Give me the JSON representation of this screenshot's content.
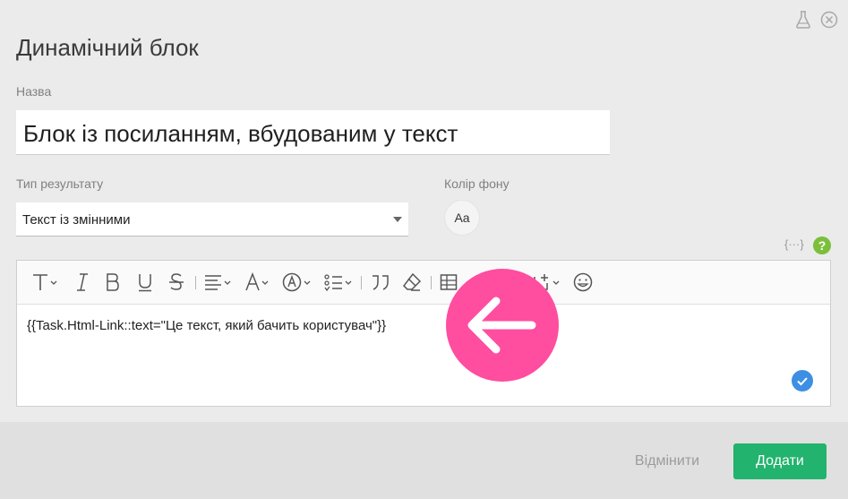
{
  "dialog": {
    "title": "Динамічний блок",
    "name_label": "Назва",
    "name_value": "Блок із посиланням, вбудованим у текст",
    "result_type_label": "Тип результату",
    "result_type_value": "Текст із змінними",
    "bg_color_label": "Колір фону",
    "bg_color_sample": "Aa",
    "variables_icon_text": "{···}",
    "help_icon_text": "?"
  },
  "editor": {
    "content": "{{Task.Html-Link::text=\"Це текст, який бачить користувач\"}}",
    "toolbar_icons": [
      "text-style-icon",
      "italic-icon",
      "bold-icon",
      "underline-icon",
      "strikethrough-icon",
      "align-icon",
      "font-color-icon",
      "highlight-icon",
      "list-icon",
      "quote-icon",
      "eraser-icon",
      "table-icon",
      "link-icon",
      "insert-icon",
      "emoji-icon"
    ]
  },
  "footer": {
    "cancel_label": "Відмінити",
    "add_label": "Додати"
  },
  "colors": {
    "accent_green": "#22b36e",
    "annotation_pink": "#ff4d9f",
    "check_blue": "#3d8fe3"
  }
}
